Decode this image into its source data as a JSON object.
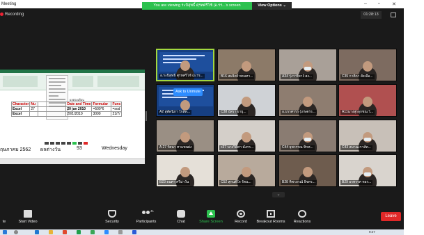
{
  "window": {
    "title": "Meeting"
  },
  "banner": {
    "text": "You are viewing ระบิสุทธิ์ ศุรทศรีโช้ (อ.รร...'s screen",
    "view_options": "View Options ⌄"
  },
  "recording": {
    "label": "Recording"
  },
  "timer": "01:28:13",
  "shared_screen": {
    "sheet_title": "ผลต่องเดือน",
    "headers": [
      "Character",
      "Nu",
      "",
      "Date and Time",
      "Formular",
      "Func"
    ],
    "rows": [
      [
        "Excel",
        "27",
        "",
        "20 jan 2010",
        "=500*6",
        "=sod"
      ],
      [
        "Excel",
        "",
        "",
        "20/1/2010",
        "3000",
        "21/7/"
      ]
    ],
    "caption_year": "ฤษภาคม 2562",
    "caption_mid": "ผลต่างวัน",
    "caption_num": "93",
    "caption_day": "Wednesday"
  },
  "ask_to_unmute": "Ask to Unmute",
  "participants": [
    {
      "name": "อ.ระบิสุทธิ์ ศุรทศรีโช้ (อ.รร...",
      "kind": "slide",
      "speaking": true
    },
    {
      "name": "B16 สมจิตร์ พรมทา...",
      "kind": "person",
      "bg": "#8c7a68",
      "mask": false
    },
    {
      "name": "A34 รุ่งวาริยาง์ สง...",
      "kind": "person",
      "bg": "#a9a098",
      "mask": true
    },
    {
      "name": "C35 กาติกา สังเมือ...",
      "kind": "person",
      "bg": "#7d6b60",
      "mask": false
    },
    {
      "name": "A2 สุพัดนิภา ใกล้ท...",
      "kind": "slide-ask",
      "speaking": false
    },
    {
      "name": "C38 บัสรา ยายุ...",
      "kind": "person",
      "bg": "#cfd2d6",
      "mask": false
    },
    {
      "name": "อ.บรรศรรร (เกษตรร...",
      "kind": "person",
      "bg": "#8e7d70",
      "mask": false
    },
    {
      "name": "A11นางสุรลุกชณ ไ...",
      "kind": "person",
      "bg": "#b05050",
      "mask": false
    },
    {
      "name": "A 27 รัตนา ทาแทนผ่ง",
      "kind": "person",
      "bg": "#9a8f84",
      "mask": false
    },
    {
      "name": "c37 นางวิดิศา มังกร...",
      "kind": "person",
      "bg": "#d4cfc9",
      "mask": false
    },
    {
      "name": "C44 ยุพวรรณ ทิกศ...",
      "kind": "person",
      "bg": "#8a7c72",
      "mask": true
    },
    {
      "name": "C43 สมาฉะราส์ท...",
      "kind": "person",
      "bg": "#c8c0b8",
      "mask": true
    },
    {
      "name": "B23 ธนศา ศรีม่าวัน",
      "kind": "person",
      "bg": "#e5e0d8",
      "mask": false
    },
    {
      "name": "C52 สุกนต์ใจ รัตน...",
      "kind": "person",
      "bg": "#b8aa9c",
      "mask": false
    },
    {
      "name": "B28 ทิพาภรณ์ ธิจทร...",
      "kind": "person",
      "bg": "#6e5c4e",
      "mask": false
    },
    {
      "name": "B29 อรทรรศ ทอร...",
      "kind": "person",
      "bg": "#d9d4ce",
      "mask": true
    }
  ],
  "toolbar": {
    "mute": "te",
    "video": "Start Video",
    "security": "Security",
    "participants": "Participants",
    "participants_count": "41",
    "chat": "Chat",
    "share": "Share Screen",
    "record": "Record",
    "rooms": "Breakout Rooms",
    "reactions": "Reactions",
    "leave": "Leave"
  },
  "taskbar": {
    "time": "9:47"
  },
  "colors": {
    "zoom_green": "#2dc14f",
    "leave_red": "#e02828",
    "speaking": "#a3d83f"
  }
}
